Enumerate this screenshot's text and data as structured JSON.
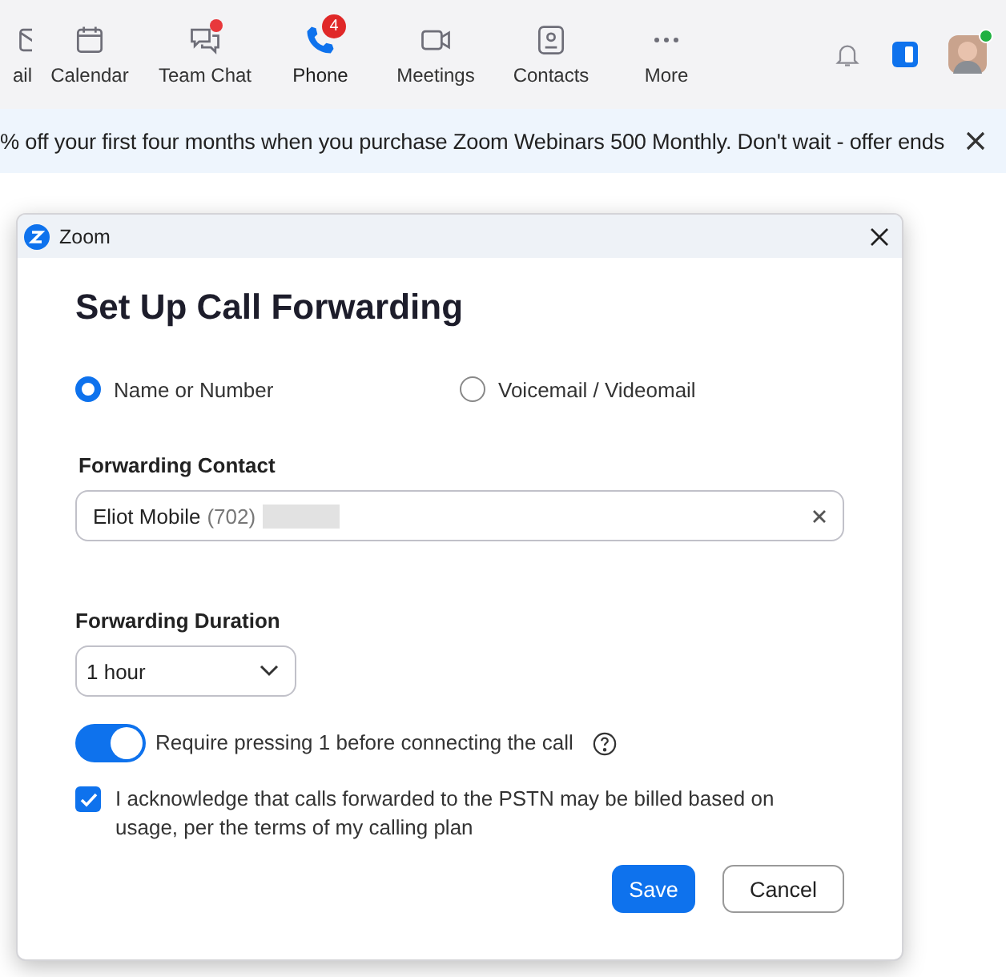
{
  "nav": [
    {
      "label": "ail",
      "kind": "mail",
      "selected": false,
      "dot": false
    },
    {
      "label": "Calendar",
      "kind": "calendar",
      "selected": false,
      "dot": false
    },
    {
      "label": "Team Chat",
      "kind": "chat",
      "selected": false,
      "dot": true
    },
    {
      "label": "Phone",
      "kind": "phone",
      "selected": true,
      "dot": false,
      "badge": "4"
    },
    {
      "label": "Meetings",
      "kind": "video",
      "selected": false,
      "dot": false
    },
    {
      "label": "Contacts",
      "kind": "contacts",
      "selected": false,
      "dot": false
    },
    {
      "label": "More",
      "kind": "more",
      "selected": false,
      "dot": false
    }
  ],
  "user": {
    "online": true
  },
  "banner": {
    "text": "% off your first four months when you purchase Zoom Webinars 500 Monthly. Don't wait - offer ends"
  },
  "dialog": {
    "window_title": "Zoom",
    "heading": "Set Up Call Forwarding",
    "options": [
      {
        "label": "Name or Number",
        "selected": true
      },
      {
        "label": "Voicemail / Videomail",
        "selected": false
      }
    ],
    "contact_label": "Forwarding Contact",
    "contact_name": "Eliot Mobile",
    "contact_number": "(702)",
    "duration_label": "Forwarding Duration",
    "duration": "1 hour",
    "toggle": {
      "label": "Require pressing 1 before connecting the call",
      "on": true
    },
    "acknowledge": {
      "label": "I acknowledge that calls forwarded to the PSTN may be billed based on usage, per the terms of my calling plan",
      "checked": true
    },
    "buttons": [
      {
        "label": "Save",
        "kind": "primary"
      },
      {
        "label": "Cancel",
        "kind": "secondary"
      }
    ]
  }
}
